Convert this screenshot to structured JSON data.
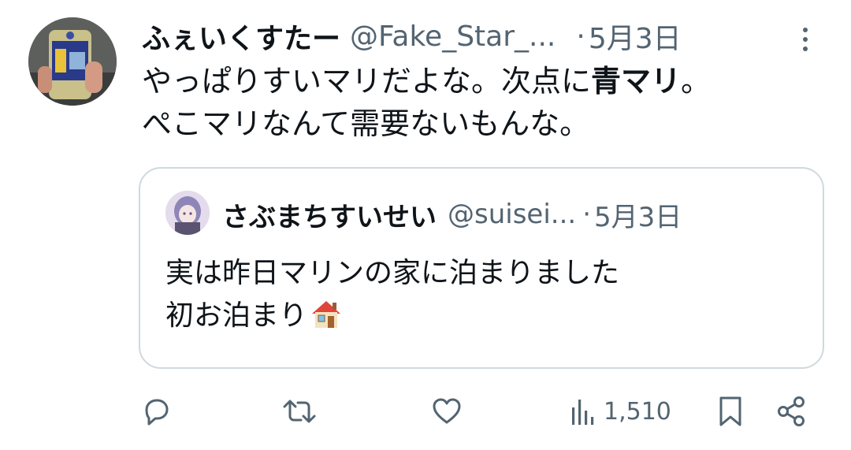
{
  "tweet": {
    "display_name": "ふぇいくすたー",
    "handle": "@Fake_Star_...",
    "separator": "·",
    "date": "5月3日",
    "body_line1_before": "やっぱりすいマリだよな。次点に",
    "body_line1_bold": "青マリ",
    "body_line1_after": "。",
    "body_line2": "ぺこマリなんて需要ないもんな。"
  },
  "quoted_tweet": {
    "display_name": "さぶまちすいせい",
    "handle": "@suisei...",
    "separator": "·",
    "date": "5月3日",
    "body_line1": "実は昨日マリンの家に泊まりました",
    "body_line2": "初お泊まり",
    "emoji": "house-emoji"
  },
  "actions": {
    "reply_icon": "reply-icon",
    "retweet_icon": "retweet-icon",
    "like_icon": "like-icon",
    "views_icon": "views-icon",
    "views_count": "1,510",
    "bookmark_icon": "bookmark-icon",
    "share_icon": "share-icon"
  },
  "colors": {
    "text_primary": "#0f1419",
    "text_secondary": "#536471",
    "border": "#cfd9de"
  }
}
